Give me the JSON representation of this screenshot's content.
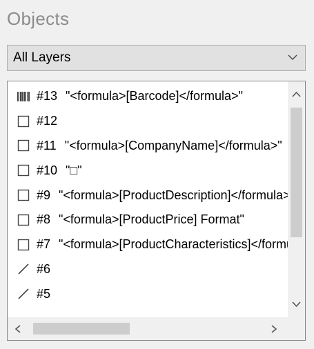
{
  "panel": {
    "title": "Objects"
  },
  "layer_select": {
    "selected": "All Layers",
    "icon": "chevron-down-icon"
  },
  "objects": [
    {
      "id": "#13",
      "text": "\"<formula>[Barcode]</formula>\"",
      "icon": "barcode-icon"
    },
    {
      "id": "#12",
      "text": "",
      "icon": "rectangle-icon"
    },
    {
      "id": "#11",
      "text": "\"<formula>[CompanyName]</formula>\"",
      "icon": "rectangle-icon"
    },
    {
      "id": "#10",
      "text": "\"□\"",
      "icon": "rectangle-icon"
    },
    {
      "id": "#9",
      "text": "\"<formula>[ProductDescription]</formula>\"",
      "icon": "rectangle-icon"
    },
    {
      "id": "#8",
      "text": "\"<formula>[ProductPrice] Format\"",
      "icon": "rectangle-icon"
    },
    {
      "id": "#7",
      "text": "\"<formula>[ProductCharacteristics]</formula>\"",
      "icon": "rectangle-icon"
    },
    {
      "id": "#6",
      "text": "",
      "icon": "line-icon"
    },
    {
      "id": "#5",
      "text": "",
      "icon": "line-icon"
    }
  ],
  "colors": {
    "title": "#8c8c8c",
    "select_bg": "#e1e1e1",
    "list_bg": "#ffffff",
    "scroll_thumb": "#cdcdcd"
  }
}
